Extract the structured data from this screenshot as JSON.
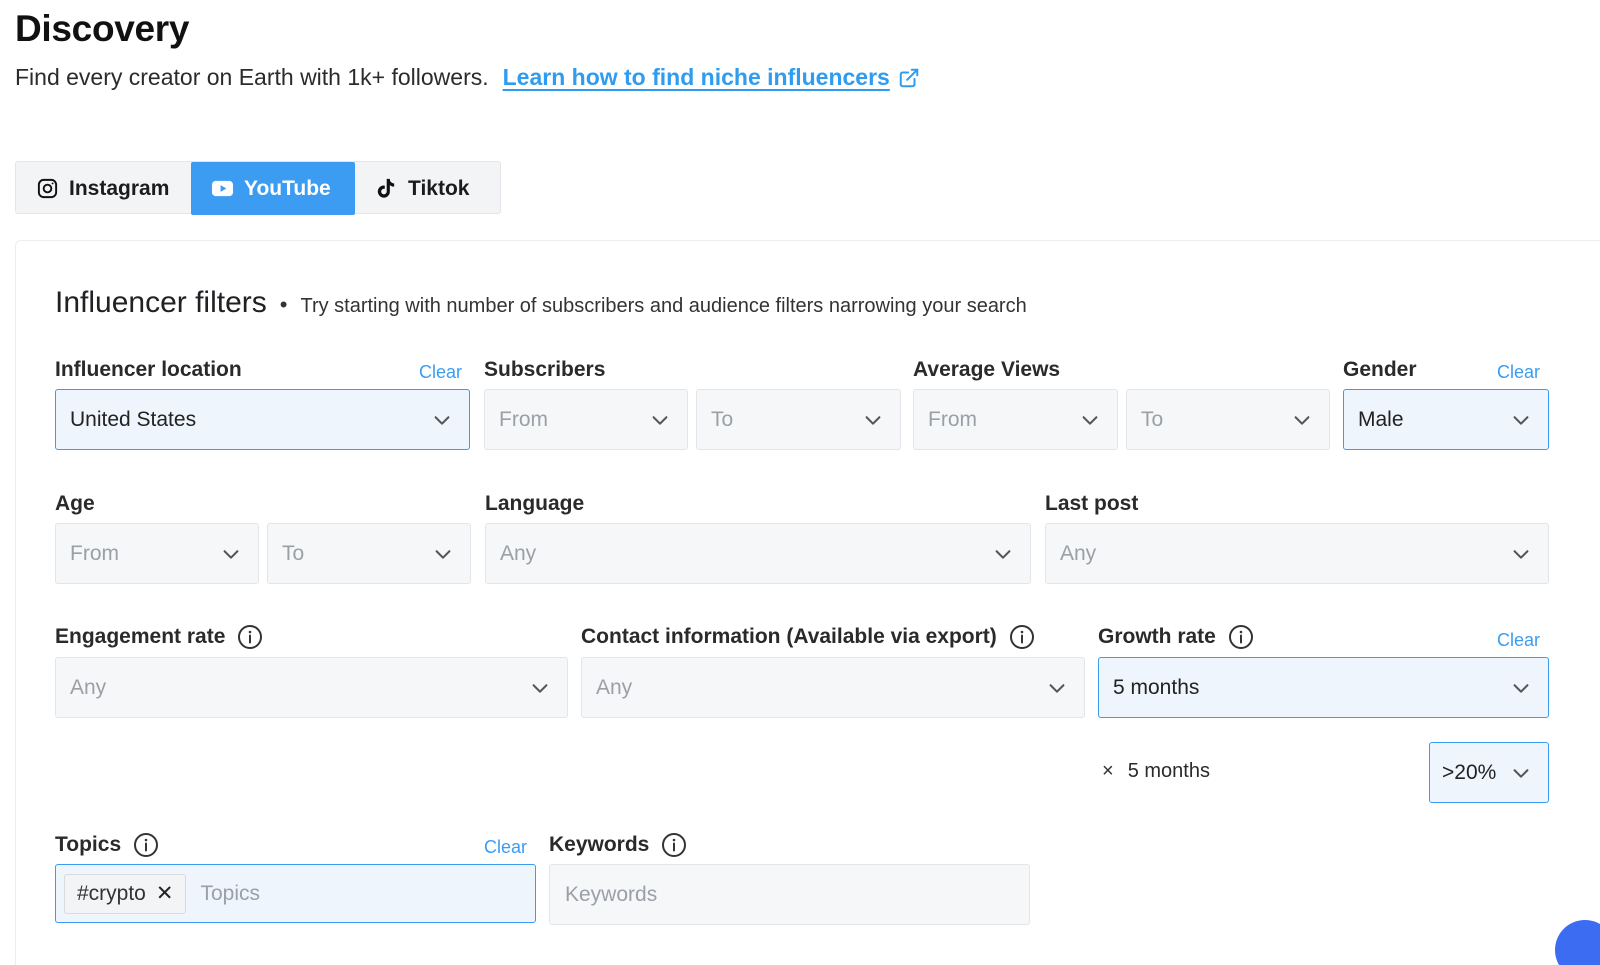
{
  "header": {
    "title": "Discovery",
    "subtitle": "Find every creator on Earth with 1k+ followers.",
    "learn_link": "Learn how to find niche influencers"
  },
  "tabs": [
    {
      "label": "Instagram",
      "icon": "instagram-icon",
      "active": false
    },
    {
      "label": "YouTube",
      "icon": "youtube-icon",
      "active": true
    },
    {
      "label": "Tiktok",
      "icon": "tiktok-icon",
      "active": false
    }
  ],
  "filters": {
    "heading": "Influencer filters",
    "separator": "•",
    "hint": "Try starting with number of subscribers and audience filters narrowing your search",
    "clear_label": "Clear",
    "location": {
      "label": "Influencer location",
      "value": "United States"
    },
    "subscribers": {
      "label": "Subscribers",
      "from": "From",
      "to": "To"
    },
    "average_views": {
      "label": "Average Views",
      "from": "From",
      "to": "To"
    },
    "gender": {
      "label": "Gender",
      "value": "Male"
    },
    "age": {
      "label": "Age",
      "from": "From",
      "to": "To"
    },
    "language": {
      "label": "Language",
      "value": "Any"
    },
    "last_post": {
      "label": "Last post",
      "value": "Any"
    },
    "engagement_rate": {
      "label": "Engagement rate",
      "value": "Any"
    },
    "contact_info": {
      "label": "Contact information (Available via export)",
      "value": "Any"
    },
    "growth_rate": {
      "label": "Growth rate",
      "value": "5 months",
      "selected_chip": "5 months",
      "chip_remove": "×",
      "threshold": ">20%"
    },
    "topics": {
      "label": "Topics",
      "tags": [
        "#crypto"
      ],
      "tag_remove": "✕",
      "placeholder": "Topics"
    },
    "keywords": {
      "label": "Keywords",
      "placeholder": "Keywords"
    }
  },
  "colors": {
    "accent": "#3b9cf2",
    "active_field_bg": "#eef5fd",
    "field_bg": "#f6f7f9"
  }
}
